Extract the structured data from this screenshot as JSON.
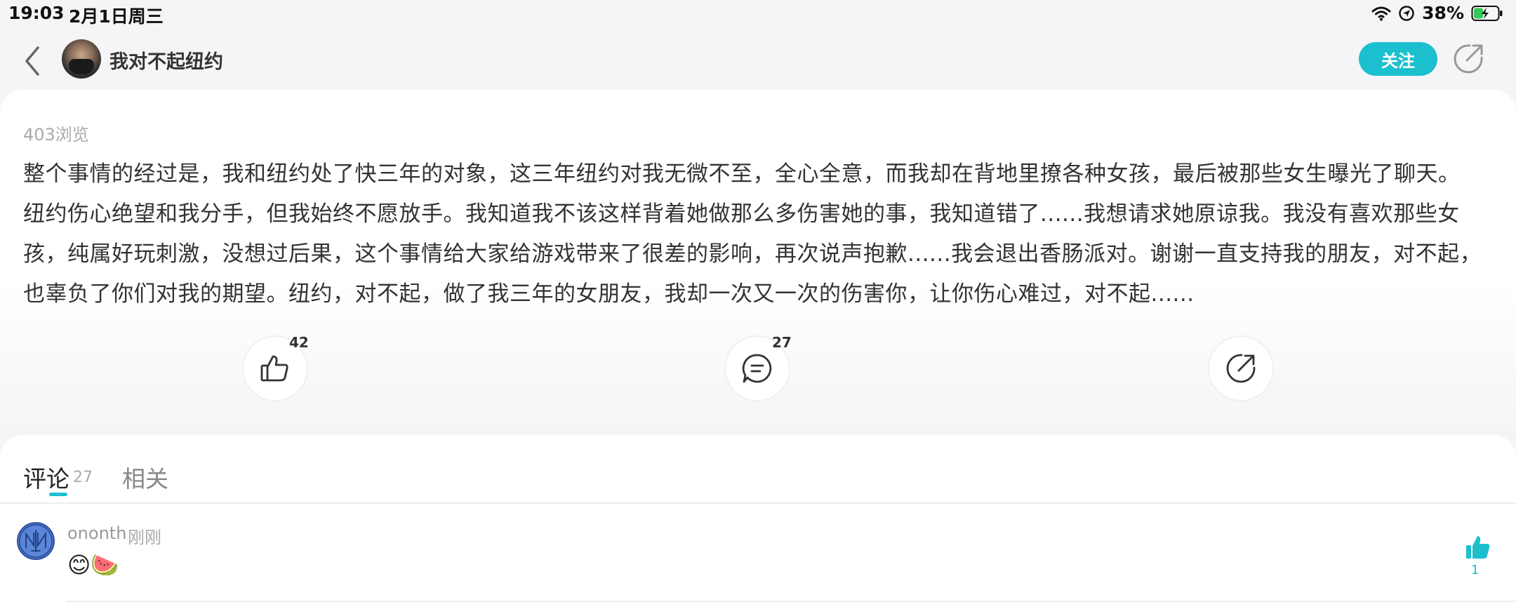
{
  "status_bar": {
    "time": "19:03",
    "date": "2月1日周三",
    "battery": "38%",
    "icons": [
      "wifi-icon",
      "location-icon",
      "battery-charging-icon"
    ]
  },
  "header": {
    "author_name": "我对不起纽约",
    "follow_label": "关注",
    "icons": [
      "back-icon",
      "share-icon"
    ]
  },
  "post": {
    "views": "403浏览",
    "lines": [
      "整个事情的经过是，我和纽约处了快三年的对象，这三年纽约对我无微不至，全心全意，而我却在背地里撩各种女孩，最后被那些女生曝光了聊天。",
      "纽约伤心绝望和我分手，但我始终不愿放手。我知道我不该这样背着她做那么多伤害她的事，我知道错了......我想请求她原谅我。我没有喜欢那些女",
      "孩，纯属好玩刺激，没想过后果，这个事情给大家给游戏带来了很差的影响，再次说声抱歉......我会退出香肠派对。谢谢一直支持我的朋友，对不起，",
      "也辜负了你们对我的期望。纽约，对不起，做了我三年的女朋友，我却一次又一次的伤害你，让你伤心难过，对不起......"
    ],
    "like_count": "42",
    "comment_count": "27"
  },
  "tabs": {
    "comments_label": "评论",
    "comments_count": "27",
    "related_label": "相关",
    "active": "comments"
  },
  "comments": [
    {
      "user": "ononth",
      "time": "刚刚",
      "text": "😊🍉",
      "likes": "1"
    }
  ],
  "colors": {
    "accent": "#1cbfce",
    "background": "#f4f5f7",
    "card": "#ffffff"
  }
}
